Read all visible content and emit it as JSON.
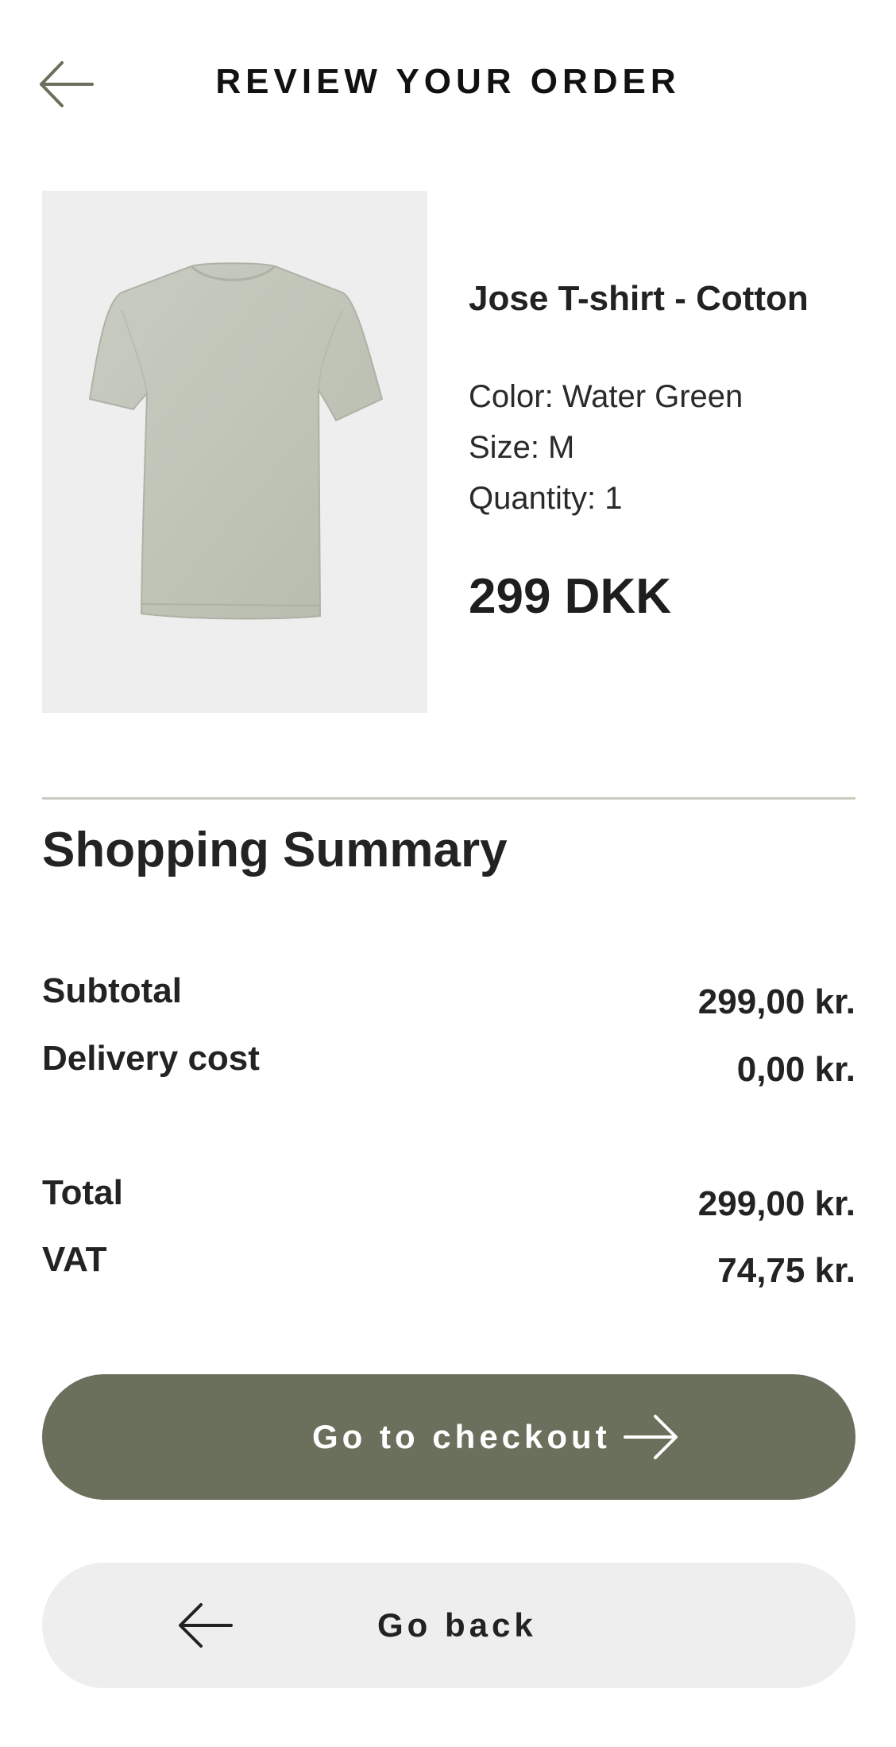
{
  "header": {
    "title": "REVIEW YOUR ORDER",
    "back_icon": "arrow-left-icon"
  },
  "product": {
    "image_icon": "t-shirt-image",
    "name": "Jose T-shirt - Cotton",
    "color_text": "Color: Water Green",
    "size_text": "Size: M",
    "quantity_text": "Quantity: 1",
    "price": "299 DKK",
    "shirt_color": "#c2c6bb"
  },
  "summary": {
    "title": "Shopping Summary",
    "subtotal_label": "Subtotal",
    "subtotal_value": "299,00 kr.",
    "delivery_label": "Delivery cost",
    "delivery_value": "0,00 kr.",
    "total_label": "Total",
    "total_value": "299,00 kr.",
    "vat_label": "VAT",
    "vat_value": "74,75 kr."
  },
  "actions": {
    "checkout_label": "Go to checkout",
    "checkout_icon": "arrow-right-icon",
    "back_label": "Go back",
    "back_icon": "arrow-left-icon"
  },
  "colors": {
    "accent": "#6b705c",
    "button_secondary": "#eeeeee",
    "image_background": "#eeeeee",
    "divider": "#c9cbbf"
  }
}
